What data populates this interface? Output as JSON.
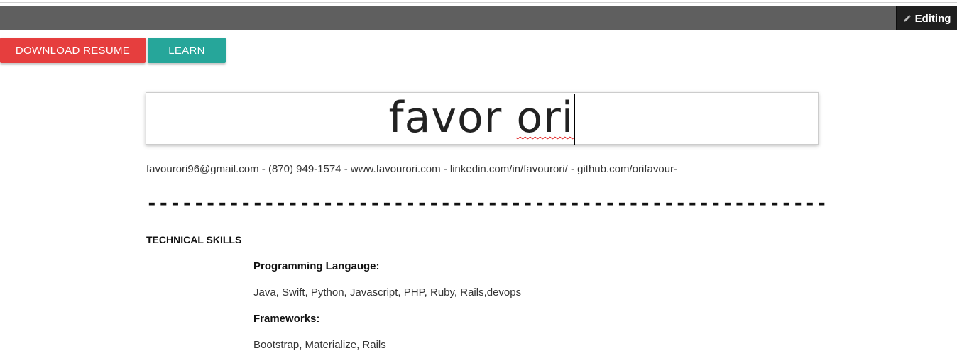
{
  "header": {
    "editing_label": "Editing",
    "editing_icon": "pencil-icon"
  },
  "buttons": {
    "download_label": "DOWNLOAD RESUME",
    "learn_label": "LEARN",
    "download_color": "#e63e3e",
    "learn_color": "#26a69a"
  },
  "resume": {
    "name_part1": "favor ",
    "name_part2": "ori",
    "contact": "favourori96@gmail.com - (870) 949-1574 - www.favourori.com - linkedin.com/in/favourori/ - github.com/orifavour-",
    "divider": "----------------------------------------------------------",
    "section_title": "TECHNICAL SKILLS",
    "skills": [
      {
        "label": "Programming Langauge:",
        "value": "Java, Swift, Python, Javascript, PHP, Ruby, Rails,devops"
      },
      {
        "label": "Frameworks:",
        "value": "Bootstrap, Materialize, Rails"
      }
    ]
  }
}
